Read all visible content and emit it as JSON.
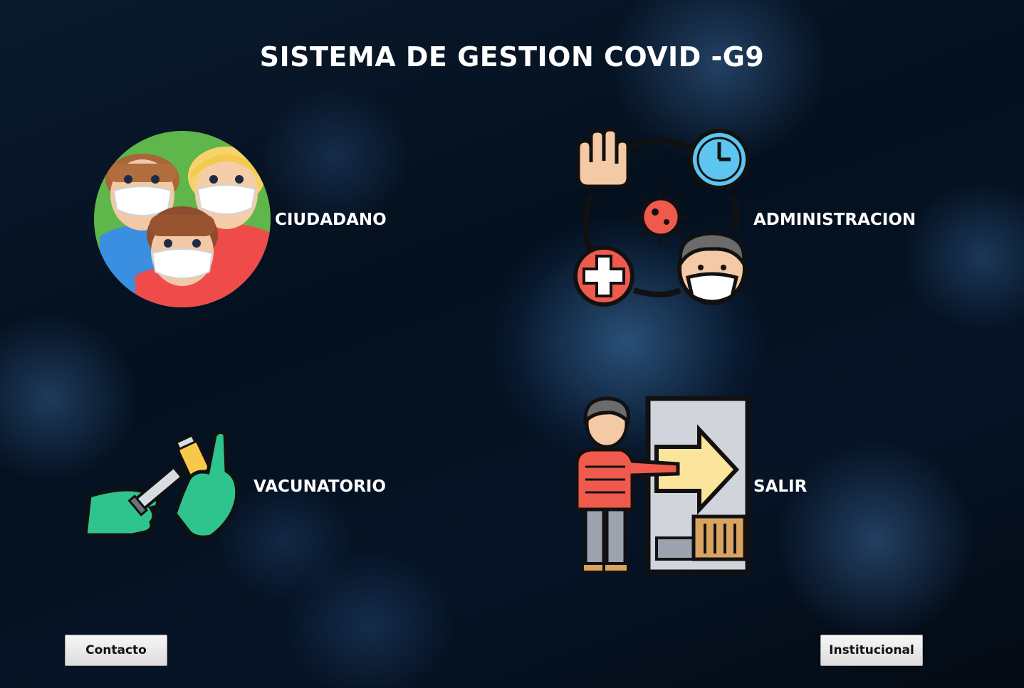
{
  "window": {
    "title": "SISTEMA DE GESTION COVID -G9"
  },
  "menu": {
    "ciudadano_label": "CIUDADANO",
    "administracion_label": "ADMINISTRACION",
    "vacunatorio_label": "VACUNATORIO",
    "salir_label": "SALIR"
  },
  "footer": {
    "contacto_label": "Contacto",
    "institucional_label": "Institucional"
  },
  "icons": {
    "ciudadano": "masked-people-icon",
    "administracion": "covid-admin-icon",
    "vacunatorio": "vaccine-syringe-icon",
    "salir": "exit-door-icon"
  },
  "colors": {
    "background": "#04101e",
    "text": "#ffffff",
    "button_bg": "#e6e6e6"
  }
}
